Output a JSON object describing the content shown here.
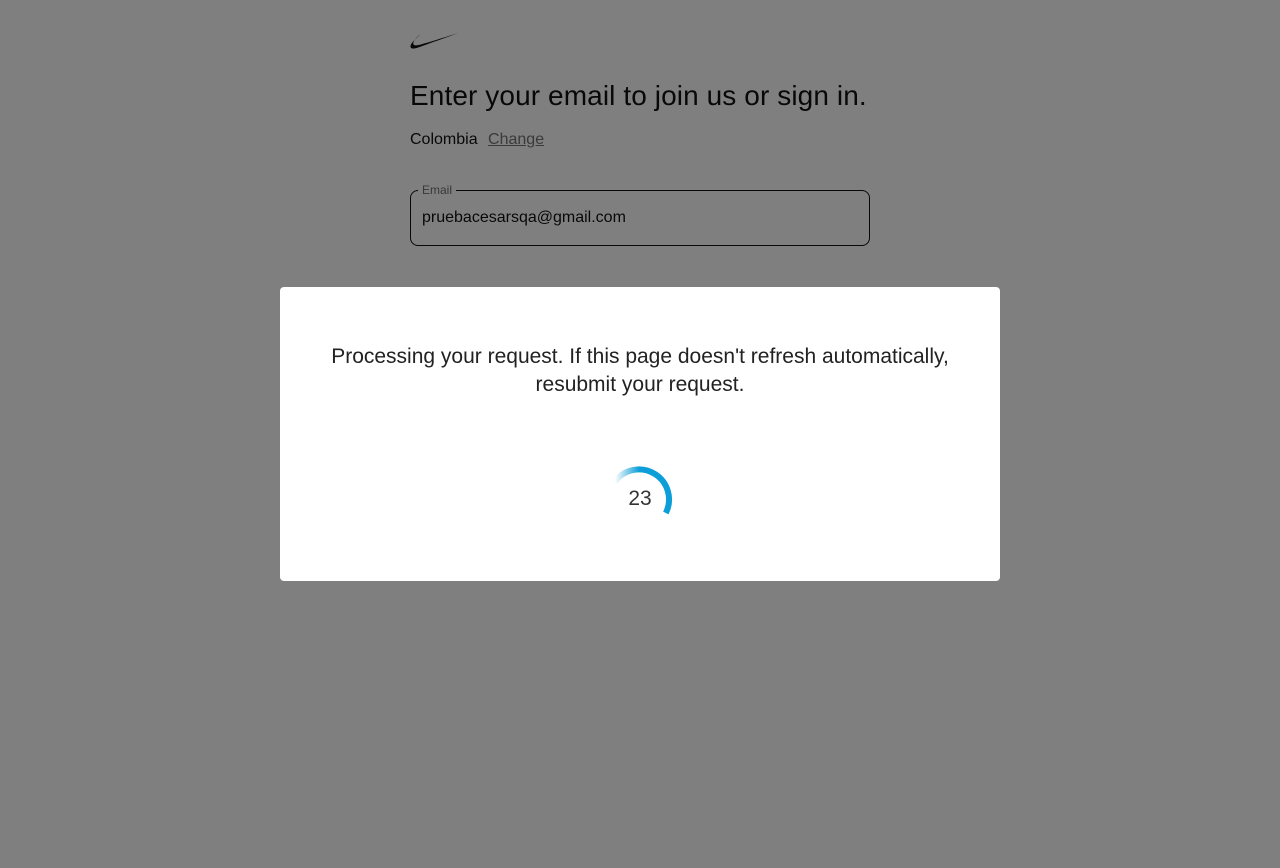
{
  "header": {
    "logo_icon": "nike-swoosh-icon"
  },
  "login": {
    "headline": "Enter your email to join us or sign in.",
    "country": "Colombia",
    "change_label": "Change",
    "email_label": "Email",
    "email_value": "pruebacesarsqa@gmail.com"
  },
  "modal": {
    "message": "Processing your request. If this page doesn't refresh automatically, resubmit your request.",
    "countdown": "23",
    "spinner_icon": "loading-spinner-icon",
    "spinner_color": "#0b9ed8"
  },
  "colors": {
    "overlay": "rgba(0,0,0,0.5)",
    "text": "#111111",
    "link": "#757575"
  }
}
